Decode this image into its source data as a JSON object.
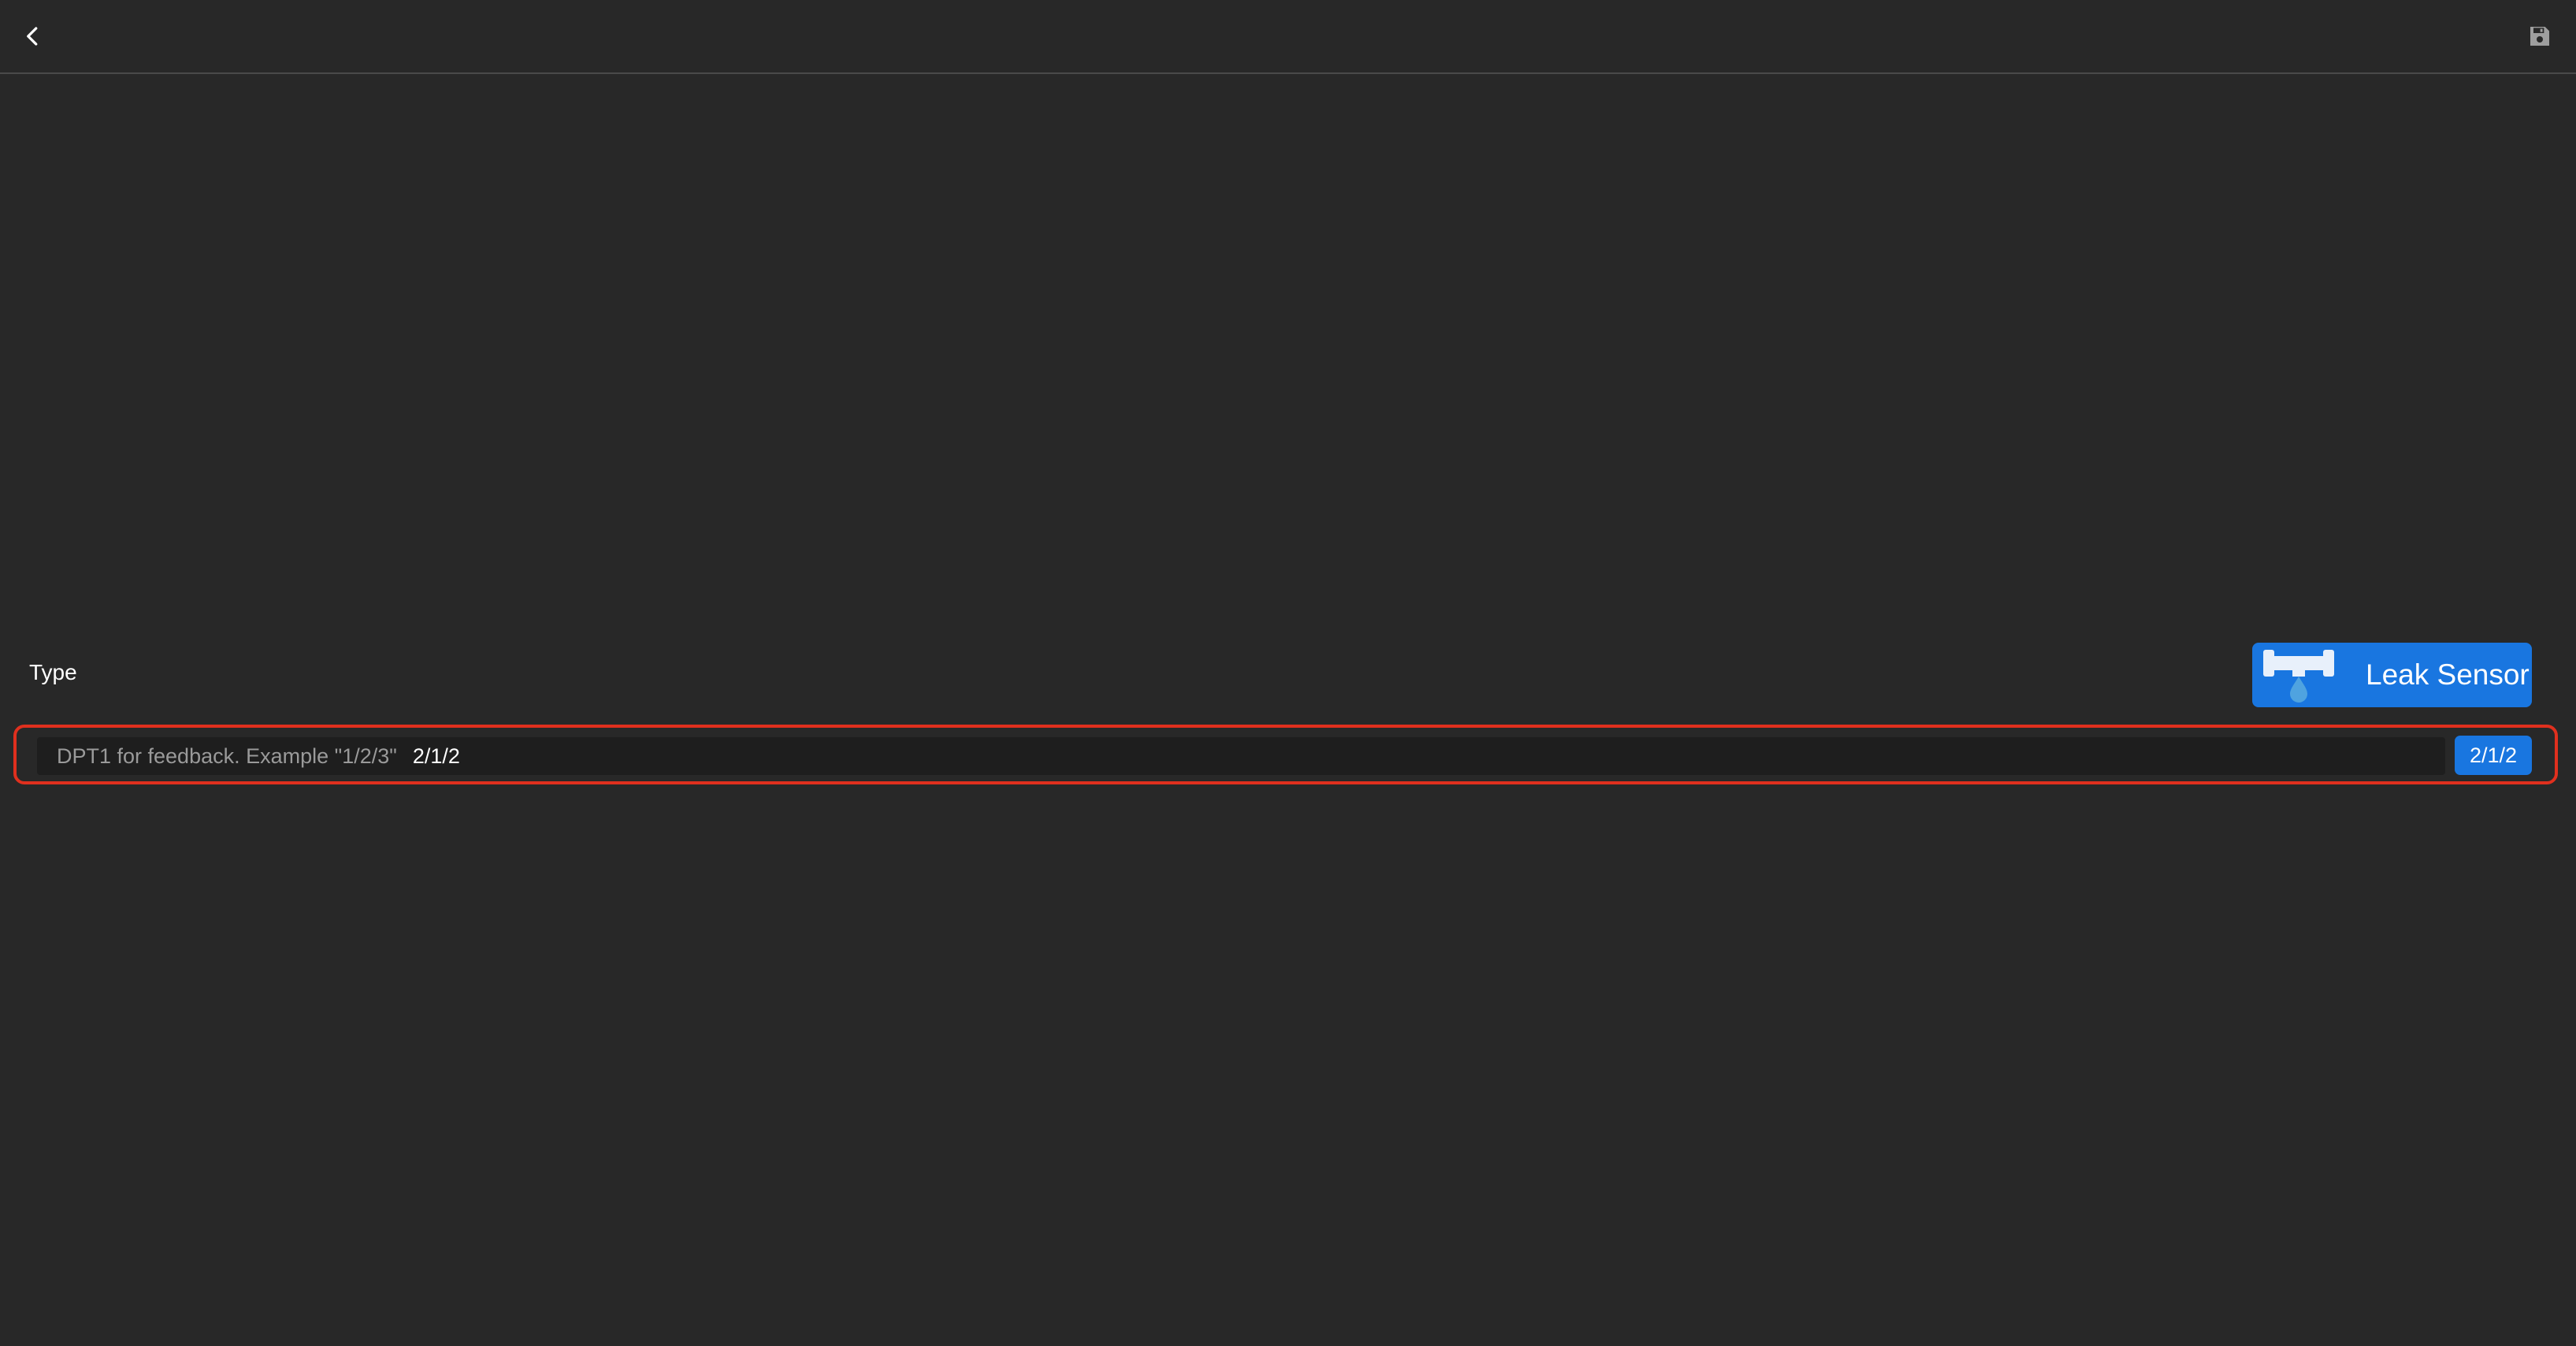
{
  "header": {
    "back_icon": "chevron-left-icon",
    "save_icon": "floppy-disk-icon"
  },
  "type_row": {
    "label": "Type",
    "button_label": "Leak Sensor",
    "button_icon": "leak-sensor-icon"
  },
  "address": {
    "placeholder": "DPT1 for feedback. Example \"1/2/3\"",
    "value": "2/1/2",
    "badge": "2/1/2"
  },
  "colors": {
    "background": "#282828",
    "accent": "#1976e0",
    "highlight": "#e0301e",
    "water_drop": "#4fa3e0"
  }
}
